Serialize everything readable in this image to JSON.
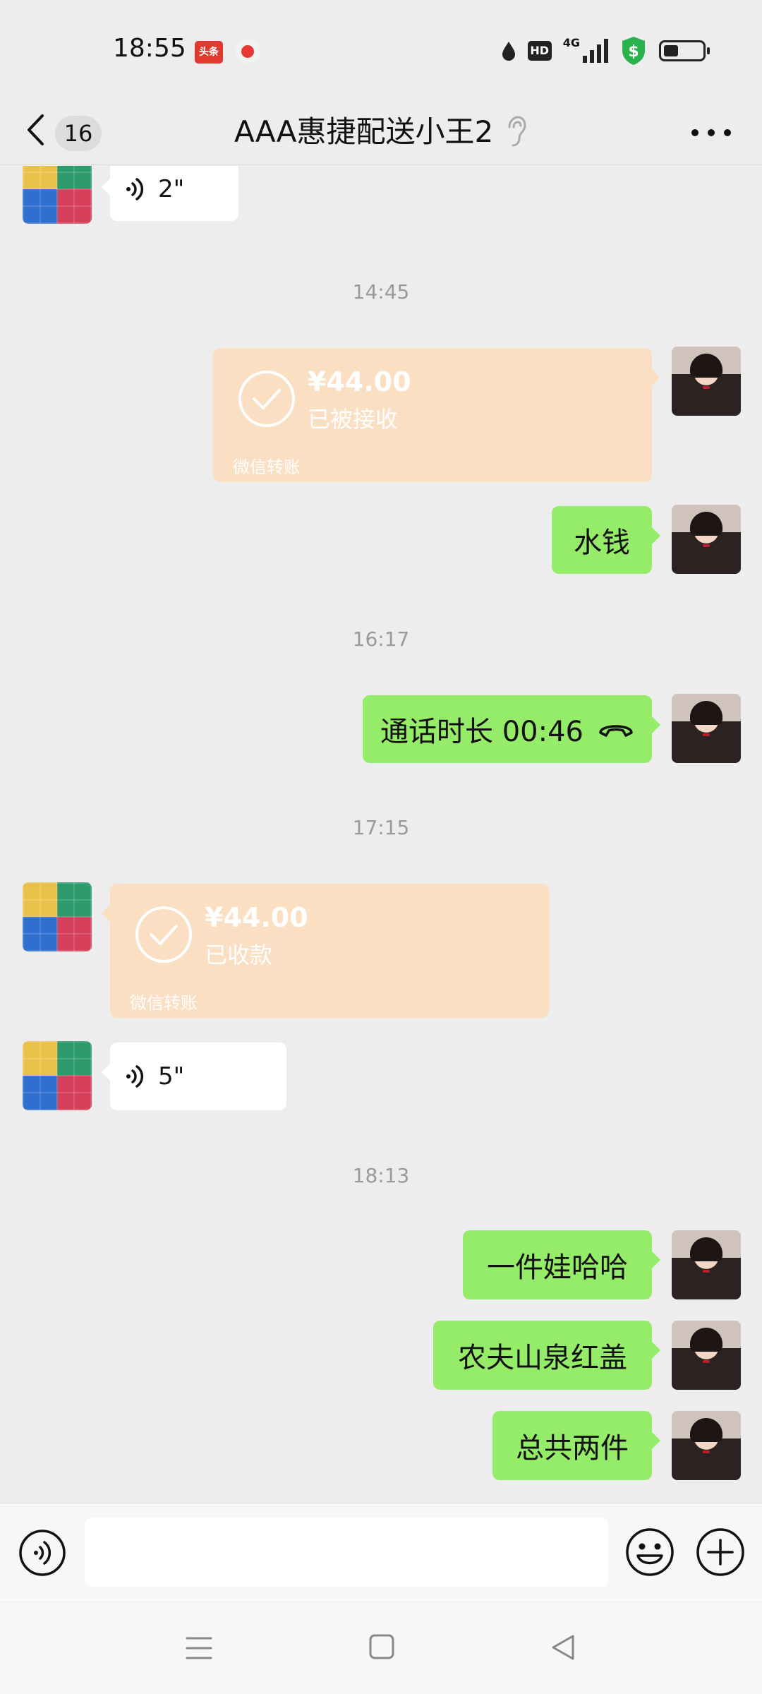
{
  "status_bar": {
    "time": "18:55",
    "app_icon_1_text": "头条",
    "app_icon_2": "video-app-icon",
    "hd_label": "HD",
    "network_label": "4G",
    "icons": [
      "water-drop-icon",
      "hd-icon",
      "signal-4g-icon",
      "security-shield-icon",
      "battery-icon"
    ]
  },
  "header": {
    "back_icon": "chevron-left-icon",
    "unread_count": "16",
    "title": "AAA惠捷配送小王2",
    "ear_icon": "earpiece-mode-icon",
    "more_icon": "more-icon"
  },
  "messages": {
    "m1": {
      "sender": "contact",
      "type": "voice",
      "duration": "2\""
    },
    "ts1": "14:45",
    "m2": {
      "sender": "me",
      "type": "transfer",
      "amount": "¥44.00",
      "status": "已被接收",
      "label": "微信转账"
    },
    "m3": {
      "sender": "me",
      "type": "text",
      "text": "水钱"
    },
    "ts2": "16:17",
    "m4": {
      "sender": "me",
      "type": "call",
      "text": "通话时长 00:46"
    },
    "ts3": "17:15",
    "m5": {
      "sender": "contact",
      "type": "transfer",
      "amount": "¥44.00",
      "status": "已收款",
      "label": "微信转账"
    },
    "m6": {
      "sender": "contact",
      "type": "voice",
      "duration": "5\""
    },
    "ts4": "18:13",
    "m7": {
      "sender": "me",
      "type": "text",
      "text": "一件娃哈哈"
    },
    "m8": {
      "sender": "me",
      "type": "text",
      "text": "农夫山泉红盖"
    },
    "m9": {
      "sender": "me",
      "type": "text",
      "text": "总共两件"
    }
  },
  "input_bar": {
    "voice_icon": "voice-input-icon",
    "text_value": "",
    "emoji_icon": "emoji-icon",
    "plus_icon": "plus-icon"
  },
  "nav_bar": {
    "icons": [
      "menu-icon",
      "home-icon",
      "back-triangle-icon"
    ]
  },
  "colors": {
    "background": "#ededed",
    "my_bubble": "#95ec69",
    "contact_bubble": "#ffffff",
    "transfer_bubble": "#fbdfc3",
    "timestamp": "#9a9a9a"
  }
}
